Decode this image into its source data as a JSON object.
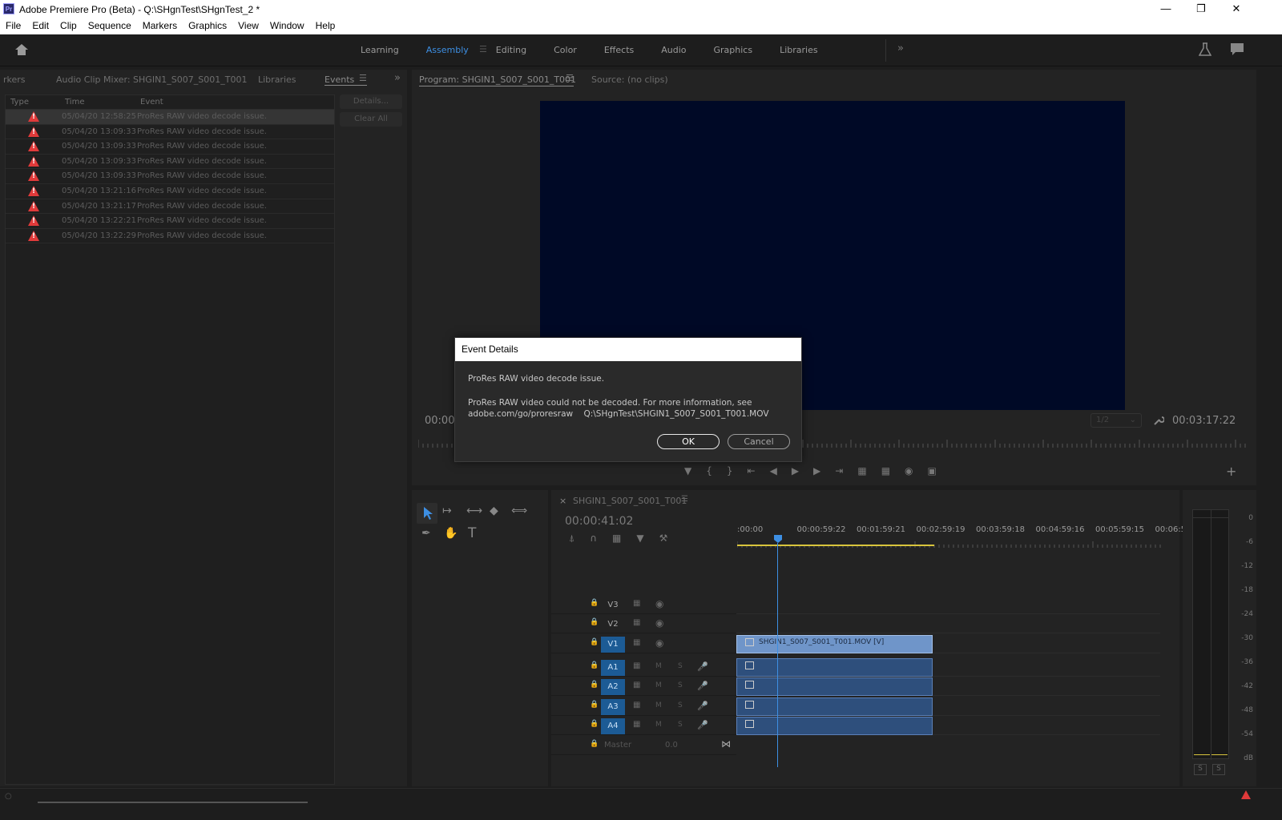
{
  "titlebar": {
    "app_icon": "Pr",
    "title": "Adobe Premiere Pro (Beta) - Q:\\SHgnTest\\SHgnTest_2 *"
  },
  "menu": [
    "File",
    "Edit",
    "Clip",
    "Sequence",
    "Markers",
    "Graphics",
    "View",
    "Window",
    "Help"
  ],
  "workspaces": [
    "Learning",
    "Assembly",
    "Editing",
    "Color",
    "Effects",
    "Audio",
    "Graphics",
    "Libraries"
  ],
  "left_panel": {
    "tabs": [
      "rkers",
      "Audio Clip Mixer: SHGIN1_S007_S001_T001",
      "Libraries",
      "Events"
    ],
    "columns": [
      "Type",
      "Time",
      "Event"
    ],
    "rows": [
      {
        "time": "05/04/20 12:58:25",
        "event": "ProRes RAW video decode issue."
      },
      {
        "time": "05/04/20 13:09:33",
        "event": "ProRes RAW video decode issue."
      },
      {
        "time": "05/04/20 13:09:33",
        "event": "ProRes RAW video decode issue."
      },
      {
        "time": "05/04/20 13:09:33",
        "event": "ProRes RAW video decode issue."
      },
      {
        "time": "05/04/20 13:09:33",
        "event": "ProRes RAW video decode issue."
      },
      {
        "time": "05/04/20 13:21:16",
        "event": "ProRes RAW video decode issue."
      },
      {
        "time": "05/04/20 13:21:17",
        "event": "ProRes RAW video decode issue."
      },
      {
        "time": "05/04/20 13:22:21",
        "event": "ProRes RAW video decode issue."
      },
      {
        "time": "05/04/20 13:22:29",
        "event": "ProRes RAW video decode issue."
      }
    ],
    "details_label": "Details...",
    "clear_label": "Clear All"
  },
  "program": {
    "tab": "Program: SHGIN1_S007_S001_T001",
    "source_tab": "Source: (no clips)",
    "timecode_left": "00:00",
    "zoom": "1/2",
    "timecode_right": "00:03:17:22"
  },
  "timeline": {
    "sequence": "SHGIN1_S007_S001_T001",
    "timecode": "00:00:41:02",
    "ruler": [
      ":00:00",
      "00:00:59:22",
      "00:01:59:21",
      "00:02:59:19",
      "00:03:59:18",
      "00:04:59:16",
      "00:05:59:15",
      "00:06:5"
    ],
    "tracks": [
      "V3",
      "V2",
      "V1",
      "A1",
      "A2",
      "A3",
      "A4"
    ],
    "master_label": "Master",
    "master_value": "0.0",
    "video_clip": "SHGIN1_S007_S001_T001.MOV [V]",
    "mute": "M",
    "solo": "S"
  },
  "meters": {
    "scale": [
      "0",
      "-6",
      "-12",
      "-18",
      "-24",
      "-30",
      "-36",
      "-42",
      "-48",
      "-54",
      "dB"
    ],
    "solo": "S"
  },
  "dialog": {
    "title": "Event Details",
    "line1": "ProRes RAW video decode issue.",
    "line2": "ProRes RAW video could not be decoded. For more information, see",
    "line3": "adobe.com/go/proresraw    Q:\\SHgnTest\\SHGIN1_S007_S001_T001.MOV",
    "ok": "OK",
    "cancel": "Cancel"
  }
}
